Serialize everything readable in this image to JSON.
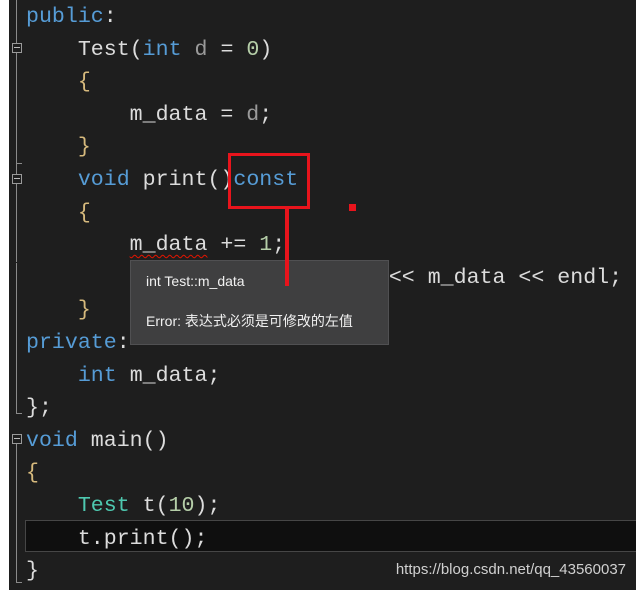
{
  "code_lines": [
    {
      "parts": [
        [
          "kw",
          "public"
        ],
        [
          "",
          ":"
        ]
      ]
    },
    {
      "parts": [
        [
          "",
          "    "
        ],
        [
          "",
          "Test"
        ],
        [
          "",
          "("
        ],
        [
          "kw",
          "int"
        ],
        [
          "",
          " "
        ],
        [
          "prm",
          "d"
        ],
        [
          "",
          " = "
        ],
        [
          "num",
          "0"
        ],
        [
          "",
          ")"
        ]
      ]
    },
    {
      "parts": [
        [
          "",
          "    "
        ],
        [
          "brace",
          "{"
        ]
      ]
    },
    {
      "parts": [
        [
          "",
          "        m_data = "
        ],
        [
          "prm",
          "d"
        ],
        [
          "",
          ";"
        ]
      ]
    },
    {
      "parts": [
        [
          "",
          "    "
        ],
        [
          "brace",
          "}"
        ]
      ]
    },
    {
      "parts": [
        [
          "",
          "    "
        ],
        [
          "kw",
          "void"
        ],
        [
          "",
          " print()"
        ],
        [
          "kw",
          "const"
        ]
      ]
    },
    {
      "parts": [
        [
          "",
          "    "
        ],
        [
          "brace",
          "{"
        ]
      ]
    },
    {
      "parts": [
        [
          "",
          "        "
        ],
        [
          "squiggle",
          "m_data"
        ],
        [
          "",
          " += "
        ],
        [
          "num",
          "1"
        ],
        [
          "",
          ";"
        ]
      ]
    },
    {
      "parts": [
        [
          "",
          "                            << m_data << endl;"
        ]
      ]
    },
    {
      "parts": [
        [
          "",
          "    "
        ],
        [
          "brace",
          "}"
        ]
      ]
    },
    {
      "parts": [
        [
          "kw",
          "private"
        ],
        [
          "",
          ":"
        ]
      ]
    },
    {
      "parts": [
        [
          "",
          "    "
        ],
        [
          "kw",
          "int"
        ],
        [
          "",
          " m_data;"
        ]
      ]
    },
    {
      "parts": [
        [
          "",
          "};"
        ]
      ]
    },
    {
      "parts": [
        [
          "kw",
          "void"
        ],
        [
          "",
          " main()"
        ]
      ]
    },
    {
      "parts": [
        [
          "brace",
          "{"
        ]
      ]
    },
    {
      "parts": [
        [
          "",
          "    "
        ],
        [
          "cls",
          "Test"
        ],
        [
          "",
          " t("
        ],
        [
          "num",
          "10"
        ],
        [
          "",
          ");"
        ]
      ]
    },
    {
      "parts": [
        [
          "",
          "    t.print();"
        ]
      ]
    },
    {
      "parts": [
        [
          "",
          "}"
        ]
      ]
    }
  ],
  "tooltip": {
    "signature": "int Test::m_data",
    "error": "Error: 表达式必须是可修改的左值"
  },
  "watermark": "https://blog.csdn.net/qq_43560037",
  "colors": {
    "keyword": "#569cd6",
    "class": "#4ec9b0",
    "number": "#b5cea8",
    "annotation": "#e8141c",
    "background": "#1e1e1e"
  }
}
